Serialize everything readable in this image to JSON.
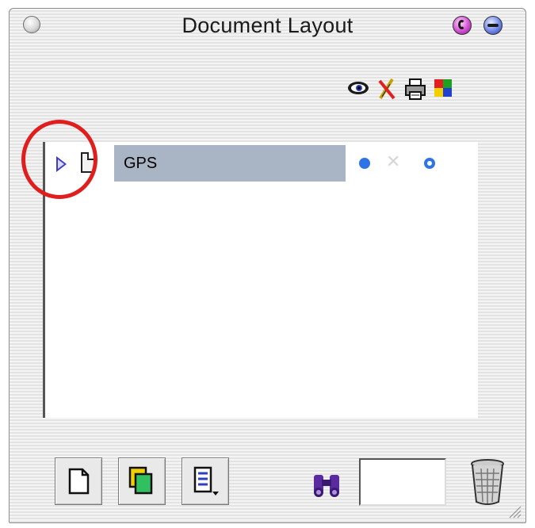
{
  "window": {
    "title": "Document Layout"
  },
  "toolbar_icons": [
    "eye-icon",
    "pen-icon",
    "printer-icon",
    "color-squares-icon"
  ],
  "list": {
    "rows": [
      {
        "label": "GPS",
        "expanded": false
      }
    ]
  },
  "bottom_buttons": [
    "new-page-icon",
    "duplicate-page-icon",
    "page-menu-icon"
  ],
  "search": {
    "value": ""
  },
  "colors": {
    "selection": "#a9b4c4",
    "accent": "#2f74e6",
    "highlight": "#e01e1e"
  }
}
